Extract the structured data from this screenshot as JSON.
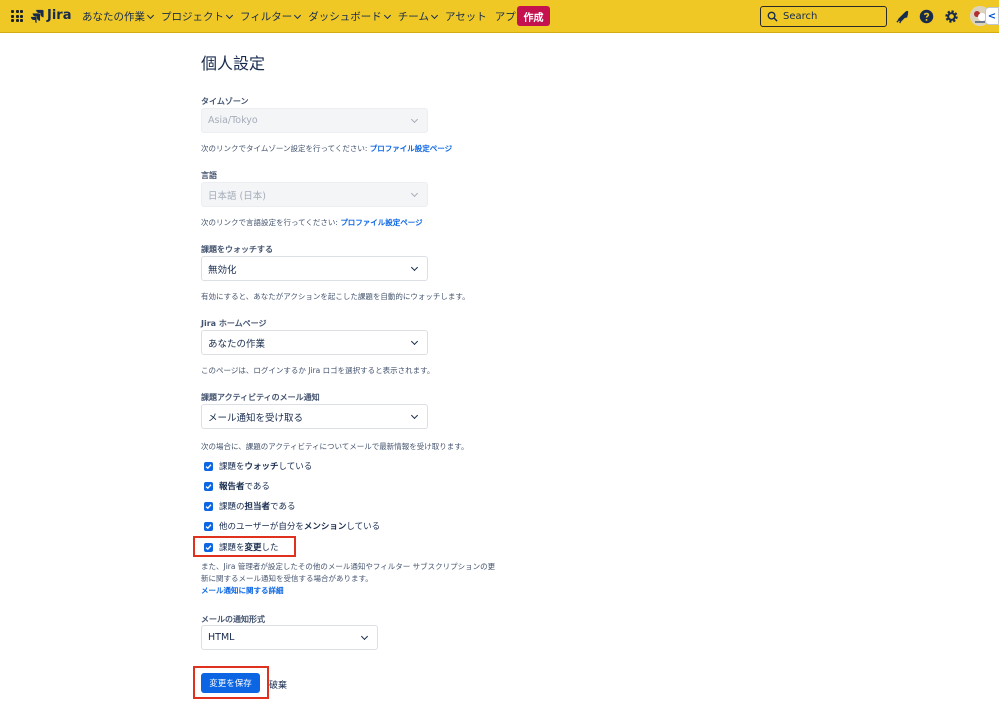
{
  "topbar": {
    "logo_text": "Jira",
    "nav": [
      "あなたの作業",
      "プロジェクト",
      "フィルター",
      "ダッシュボード",
      "チーム",
      "アセット",
      "アプリ"
    ],
    "nav_has_dropdown": [
      true,
      true,
      true,
      true,
      true,
      false,
      true
    ],
    "create_label": "作成",
    "search_placeholder": "Search",
    "brand_color": "#f0c826",
    "create_color": "#c4124e"
  },
  "page": {
    "title": "個人設定"
  },
  "timezone": {
    "label": "タイムゾーン",
    "value": "Asia/Tokyo",
    "help": "次のリンクでタイムゾーン設定を行ってください: ",
    "link": "プロファイル設定ページ"
  },
  "language": {
    "label": "言語",
    "value": "日本語 (日本)",
    "help": "次のリンクで言語設定を行ってください: ",
    "link": "プロファイル設定ページ"
  },
  "watch": {
    "label": "課題をウォッチする",
    "value": "無効化",
    "help": "有効にすると、あなたがアクションを起こした課題を自動的にウォッチします。"
  },
  "homepage": {
    "label": "Jira ホームページ",
    "value": "あなたの作業",
    "help": "このページは、ログインするか Jira ロゴを選択すると表示されます。"
  },
  "email_notify": {
    "label": "課題アクティビティのメール通知",
    "value": "メール通知を受け取る",
    "help": "次の場合に、課題のアクティビティについてメールで最新情報を受け取ります。",
    "checkboxes": [
      {
        "pre": "課題を",
        "bold": "ウォッチ",
        "post": "している",
        "checked": true
      },
      {
        "pre": "",
        "bold": "報告者",
        "post": "である",
        "checked": true
      },
      {
        "pre": "課題の",
        "bold": "担当者",
        "post": "である",
        "checked": true
      },
      {
        "pre": "他のユーザーが自分を",
        "bold": "メンション",
        "post": "している",
        "checked": true
      },
      {
        "pre": "課題を",
        "bold": "変更",
        "post": "した",
        "checked": true
      }
    ],
    "note": "また、Jira 管理者が設定したその他のメール通知やフィルター サブスクリプションの更新に関するメール通知を受信する場合があります。",
    "note_link": "メール通知に関する詳細"
  },
  "email_format": {
    "label": "メールの通知形式",
    "value": "HTML"
  },
  "actions": {
    "save": "変更を保存",
    "cancel": "破棄"
  }
}
